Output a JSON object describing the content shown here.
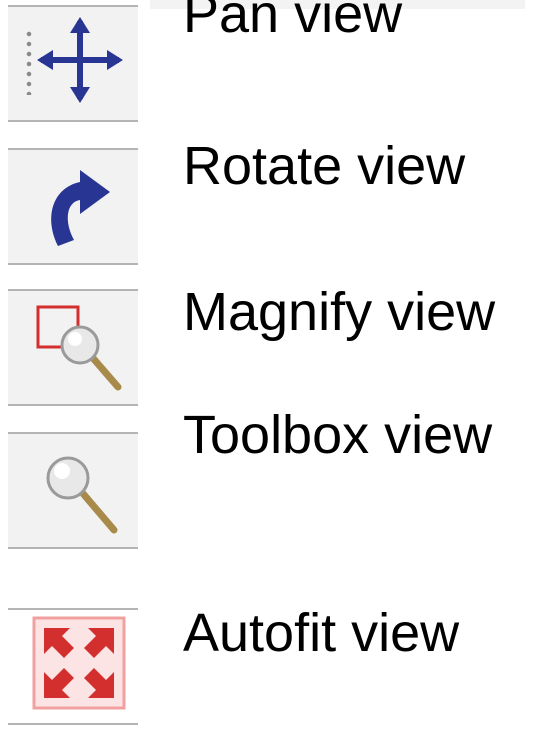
{
  "toolbar": {
    "items": [
      {
        "id": "pan",
        "label": "Pan view",
        "icon": "pan-icon"
      },
      {
        "id": "rotate",
        "label": "Rotate view",
        "icon": "rotate-icon"
      },
      {
        "id": "magnify",
        "label": "Magnify view",
        "icon": "magnify-icon"
      },
      {
        "id": "toolbox",
        "label": "Toolbox view",
        "icon": "toolbox-magnifier-icon"
      },
      {
        "id": "autofit",
        "label": "Autofit view",
        "icon": "autofit-icon"
      }
    ]
  },
  "colors": {
    "icon_blue": "#283593",
    "icon_red": "#d32f2f",
    "separator": "#b4b4b4",
    "button_bg": "#f2f2f2"
  }
}
